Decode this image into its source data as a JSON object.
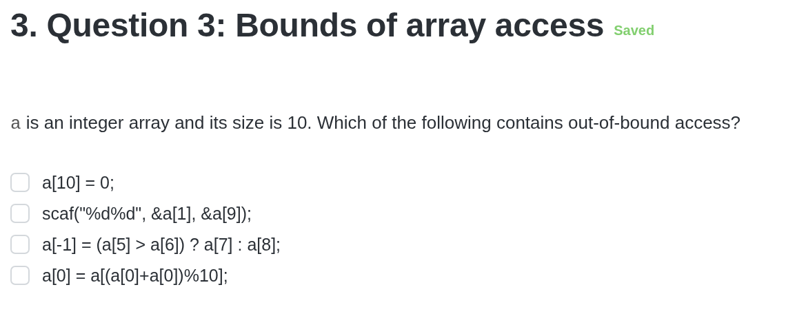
{
  "question": {
    "title": "3. Question 3: Bounds of array access",
    "status": "Saved",
    "prompt_code": "a",
    "prompt_text": "is an integer array and its size is 10. Which of the following contains out-of-bound access?"
  },
  "options": [
    {
      "label": "a[10] = 0;",
      "checked": false
    },
    {
      "label": "scaf(\"%d%d\", &a[1], &a[9]);",
      "checked": false
    },
    {
      "label": "a[-1] = (a[5] > a[6]) ? a[7] : a[8];",
      "checked": false
    },
    {
      "label": "a[0] = a[(a[0]+a[0])%10];",
      "checked": false
    }
  ]
}
